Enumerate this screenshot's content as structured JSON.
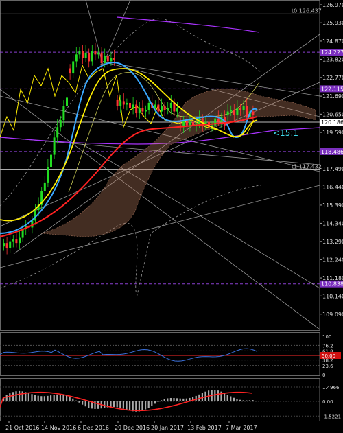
{
  "chart_data": {
    "type": "candlestick",
    "instrument": "USDJPY",
    "timeframe": "D1",
    "date_labels": [
      "21 Oct 2016",
      "14 Nov 2016",
      "6 Dec 2016",
      "29 Dec 2016",
      "20 Jan 2017",
      "13 Feb 2017",
      "7 Mar 2017"
    ],
    "price_axis": {
      "ticks": [
        "126.970",
        "125.930",
        "124.870",
        "123.820",
        "122.770",
        "121.690",
        "120.650",
        "119.590",
        "118.530",
        "117.490",
        "116.440",
        "115.390",
        "114.340",
        "113.290",
        "112.240",
        "111.180",
        "110.140",
        "109.090"
      ],
      "range": [
        108.9,
        127.4
      ]
    },
    "level_badges": [
      {
        "label": "124.227",
        "value": 124.227,
        "color": "#7b2fbe"
      },
      {
        "label": "122.115",
        "value": 122.115,
        "color": "#7b2fbe"
      },
      {
        "label": "120.186",
        "value": 120.186,
        "color": "#ffffff"
      },
      {
        "label": "118.486",
        "value": 118.486,
        "color": "#7b2fbe"
      },
      {
        "label": "110.838",
        "value": 110.838,
        "color": "#7b2fbe"
      }
    ],
    "text_labels": [
      {
        "text": "t0 126.437",
        "value": 126.437
      },
      {
        "text": "t1 117.432",
        "value": 117.432
      }
    ],
    "ratio_label": "<15:1",
    "rsi_panel": {
      "ticks": [
        "100",
        "76.2",
        "61.8",
        "50.00",
        "38.2",
        "23.6",
        "0"
      ],
      "range": [
        0,
        100
      ],
      "current": "50.00"
    },
    "macd_panel": {
      "ticks": [
        "1.4966",
        "0.00",
        "-1.5221"
      ],
      "range": [
        -1.5221,
        1.4966
      ]
    },
    "colors": {
      "bull": "#22dd22",
      "bear": "#ff3333",
      "fast_ma": "#3aa8ff",
      "mid_ma": "#ffee00",
      "slow_ma": "#ff2222",
      "long_ma": "#aa33ff",
      "badge_purple": "#7b2fbe",
      "rsi_line": "#3a6fd8",
      "macd_line": "#ff2222",
      "cloud": "#c08060"
    }
  }
}
